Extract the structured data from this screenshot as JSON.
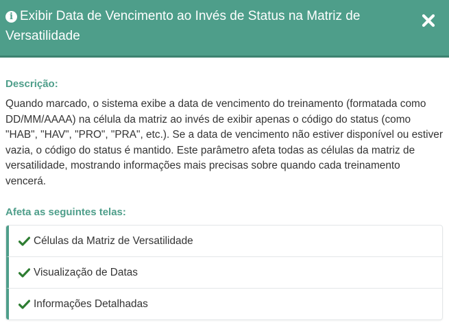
{
  "modal": {
    "title": "Exibir Data de Vencimento ao Invés de Status na Matriz de Versatilidade",
    "info_icon": "info-circle-icon",
    "close_icon": "close-x-icon"
  },
  "description": {
    "label": "Descrição:",
    "text": "Quando marcado, o sistema exibe a data de vencimento do treinamento (formatada como DD/MM/AAAA) na célula da matriz ao invés de exibir apenas o código do status (como \"HAB\", \"HAV\", \"PRO\", \"PRA\", etc.). Se a data de vencimento não estiver disponível ou estiver vazia, o código do status é mantido. Este parâmetro afeta todas as células da matriz de versatilidade, mostrando informações mais precisas sobre quando cada treinamento vencerá."
  },
  "affected_screens": {
    "label": "Afeta as seguintes telas:",
    "icon": "check-icon",
    "items": [
      "Células da Matriz de Versatilidade",
      "Visualização de Datas",
      "Informações Detalhadas"
    ]
  },
  "colors": {
    "header_bg": "#4e9e8a",
    "accent": "#4e9e8a",
    "check": "#2e7d32",
    "text": "#333333"
  }
}
